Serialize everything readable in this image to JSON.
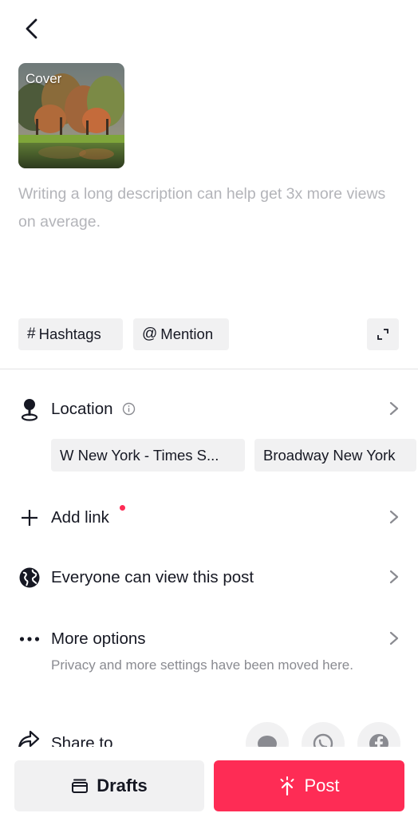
{
  "header": {
    "back_icon": "chevron-left-icon"
  },
  "cover": {
    "label": "Cover"
  },
  "description": {
    "placeholder": "Writing a long description can help get 3x more views on average."
  },
  "chips": {
    "hashtags": {
      "symbol": "#",
      "label": "Hashtags"
    },
    "mention": {
      "symbol": "@",
      "label": "Mention"
    }
  },
  "location": {
    "label": "Location",
    "suggestions": [
      "W New York - Times S...",
      "Broadway New York"
    ]
  },
  "add_link": {
    "label": "Add link"
  },
  "visibility": {
    "label": "Everyone can view this post"
  },
  "more_options": {
    "label": "More options",
    "subtitle": "Privacy and more settings have been moved here."
  },
  "share": {
    "label": "Share to",
    "targets": [
      "message-icon",
      "whatsapp-icon",
      "facebook-icon"
    ]
  },
  "bottom": {
    "drafts_label": "Drafts",
    "post_label": "Post"
  },
  "colors": {
    "accent": "#fe2c55",
    "chip_bg": "#f1f1f2",
    "text": "#161823",
    "placeholder": "#b3b4b9"
  }
}
